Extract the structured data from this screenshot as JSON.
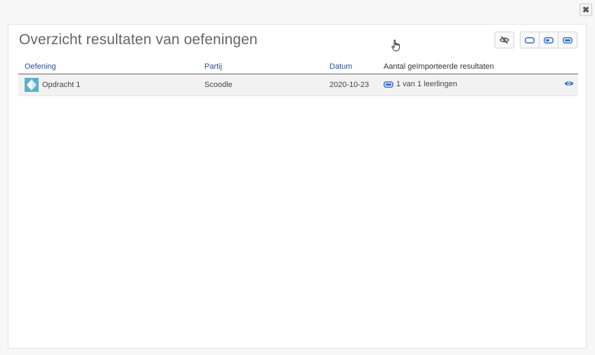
{
  "dialog": {
    "close_glyph": "✖",
    "title": "Overzicht resultaten van oefeningen"
  },
  "toolbar": {
    "buttons": [
      {
        "icon": "eye-slash-icon"
      },
      {
        "icon": "toggle-off-icon"
      },
      {
        "icon": "toggle-half-icon"
      },
      {
        "icon": "toggle-on-icon"
      }
    ]
  },
  "table": {
    "headers": {
      "oefening": "Oefening",
      "partij": "Partij",
      "datum": "Datum",
      "aantal": "Aantal geïmporteerde resultaten"
    },
    "rows": [
      {
        "oefening": "Opdracht 1",
        "partij": "Scoodle",
        "datum": "2020-10-23",
        "aantal": "1 van 1 leerlingen"
      }
    ]
  },
  "colors": {
    "accent": "#2f6fd6",
    "header_text": "#2a4f9a"
  }
}
